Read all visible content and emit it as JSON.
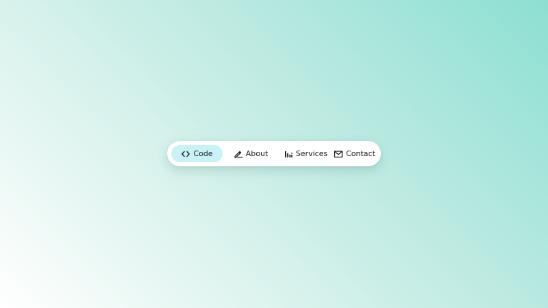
{
  "nav": {
    "items": [
      {
        "label": "Code",
        "icon": "code-icon",
        "active": true
      },
      {
        "label": "About",
        "icon": "pen-icon",
        "active": false
      },
      {
        "label": "Services",
        "icon": "bar-chart-icon",
        "active": false
      },
      {
        "label": "Contact",
        "icon": "mail-icon",
        "active": false
      }
    ]
  },
  "colors": {
    "active_bg": "#c9f2f7",
    "background_start": "#8ddfd2",
    "background_end": "#ffffff"
  }
}
